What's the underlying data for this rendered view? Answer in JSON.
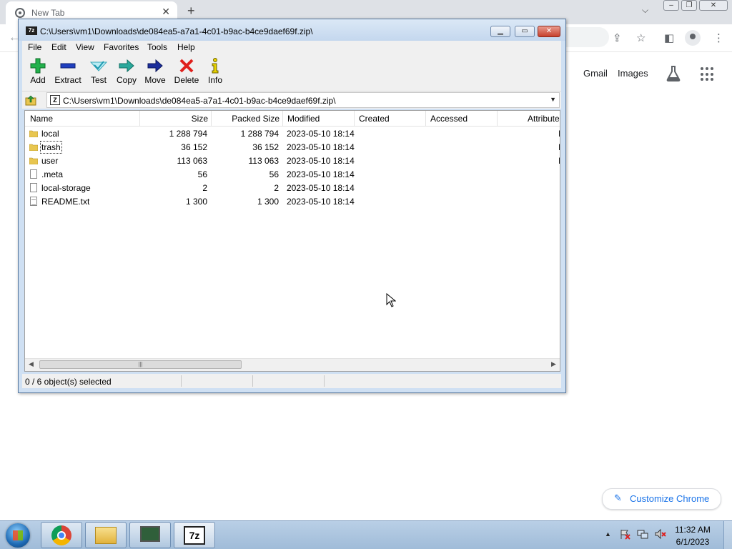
{
  "chrome": {
    "tab_title": "New Tab",
    "links": {
      "gmail": "Gmail",
      "images": "Images"
    },
    "customize_label": "Customize Chrome"
  },
  "zip_window": {
    "title": "C:\\Users\\vm1\\Downloads\\de084ea5-a7a1-4c01-b9ac-b4ce9daef69f.zip\\",
    "app_icon_text": "7z",
    "menu": [
      "File",
      "Edit",
      "View",
      "Favorites",
      "Tools",
      "Help"
    ],
    "toolbar": [
      "Add",
      "Extract",
      "Test",
      "Copy",
      "Move",
      "Delete",
      "Info"
    ],
    "address": "C:\\Users\\vm1\\Downloads\\de084ea5-a7a1-4c01-b9ac-b4ce9daef69f.zip\\",
    "columns": [
      "Name",
      "Size",
      "Packed Size",
      "Modified",
      "Created",
      "Accessed",
      "Attribute"
    ],
    "rows": [
      {
        "type": "folder",
        "name": "local",
        "size": "1 288 794",
        "packed": "1 288 794",
        "modified": "2023-05-10 18:14",
        "attr": "I"
      },
      {
        "type": "folder",
        "name": "trash",
        "size": "36 152",
        "packed": "36 152",
        "modified": "2023-05-10 18:14",
        "attr": "I"
      },
      {
        "type": "folder",
        "name": "user",
        "size": "113 063",
        "packed": "113 063",
        "modified": "2023-05-10 18:14",
        "attr": "I"
      },
      {
        "type": "file",
        "name": ".meta",
        "size": "56",
        "packed": "56",
        "modified": "2023-05-10 18:14",
        "attr": ""
      },
      {
        "type": "file",
        "name": "local-storage",
        "size": "2",
        "packed": "2",
        "modified": "2023-05-10 18:14",
        "attr": ""
      },
      {
        "type": "txt",
        "name": "README.txt",
        "size": "1 300",
        "packed": "1 300",
        "modified": "2023-05-10 18:14",
        "attr": ""
      }
    ],
    "status": "0 / 6 object(s) selected"
  },
  "taskbar": {
    "apps": [
      "start",
      "chrome-icon",
      "explorer-icon",
      "monitor-icon",
      "7zip-icon"
    ],
    "seven_zip_label": "7z",
    "time": "11:32 AM",
    "date": "6/1/2023"
  }
}
